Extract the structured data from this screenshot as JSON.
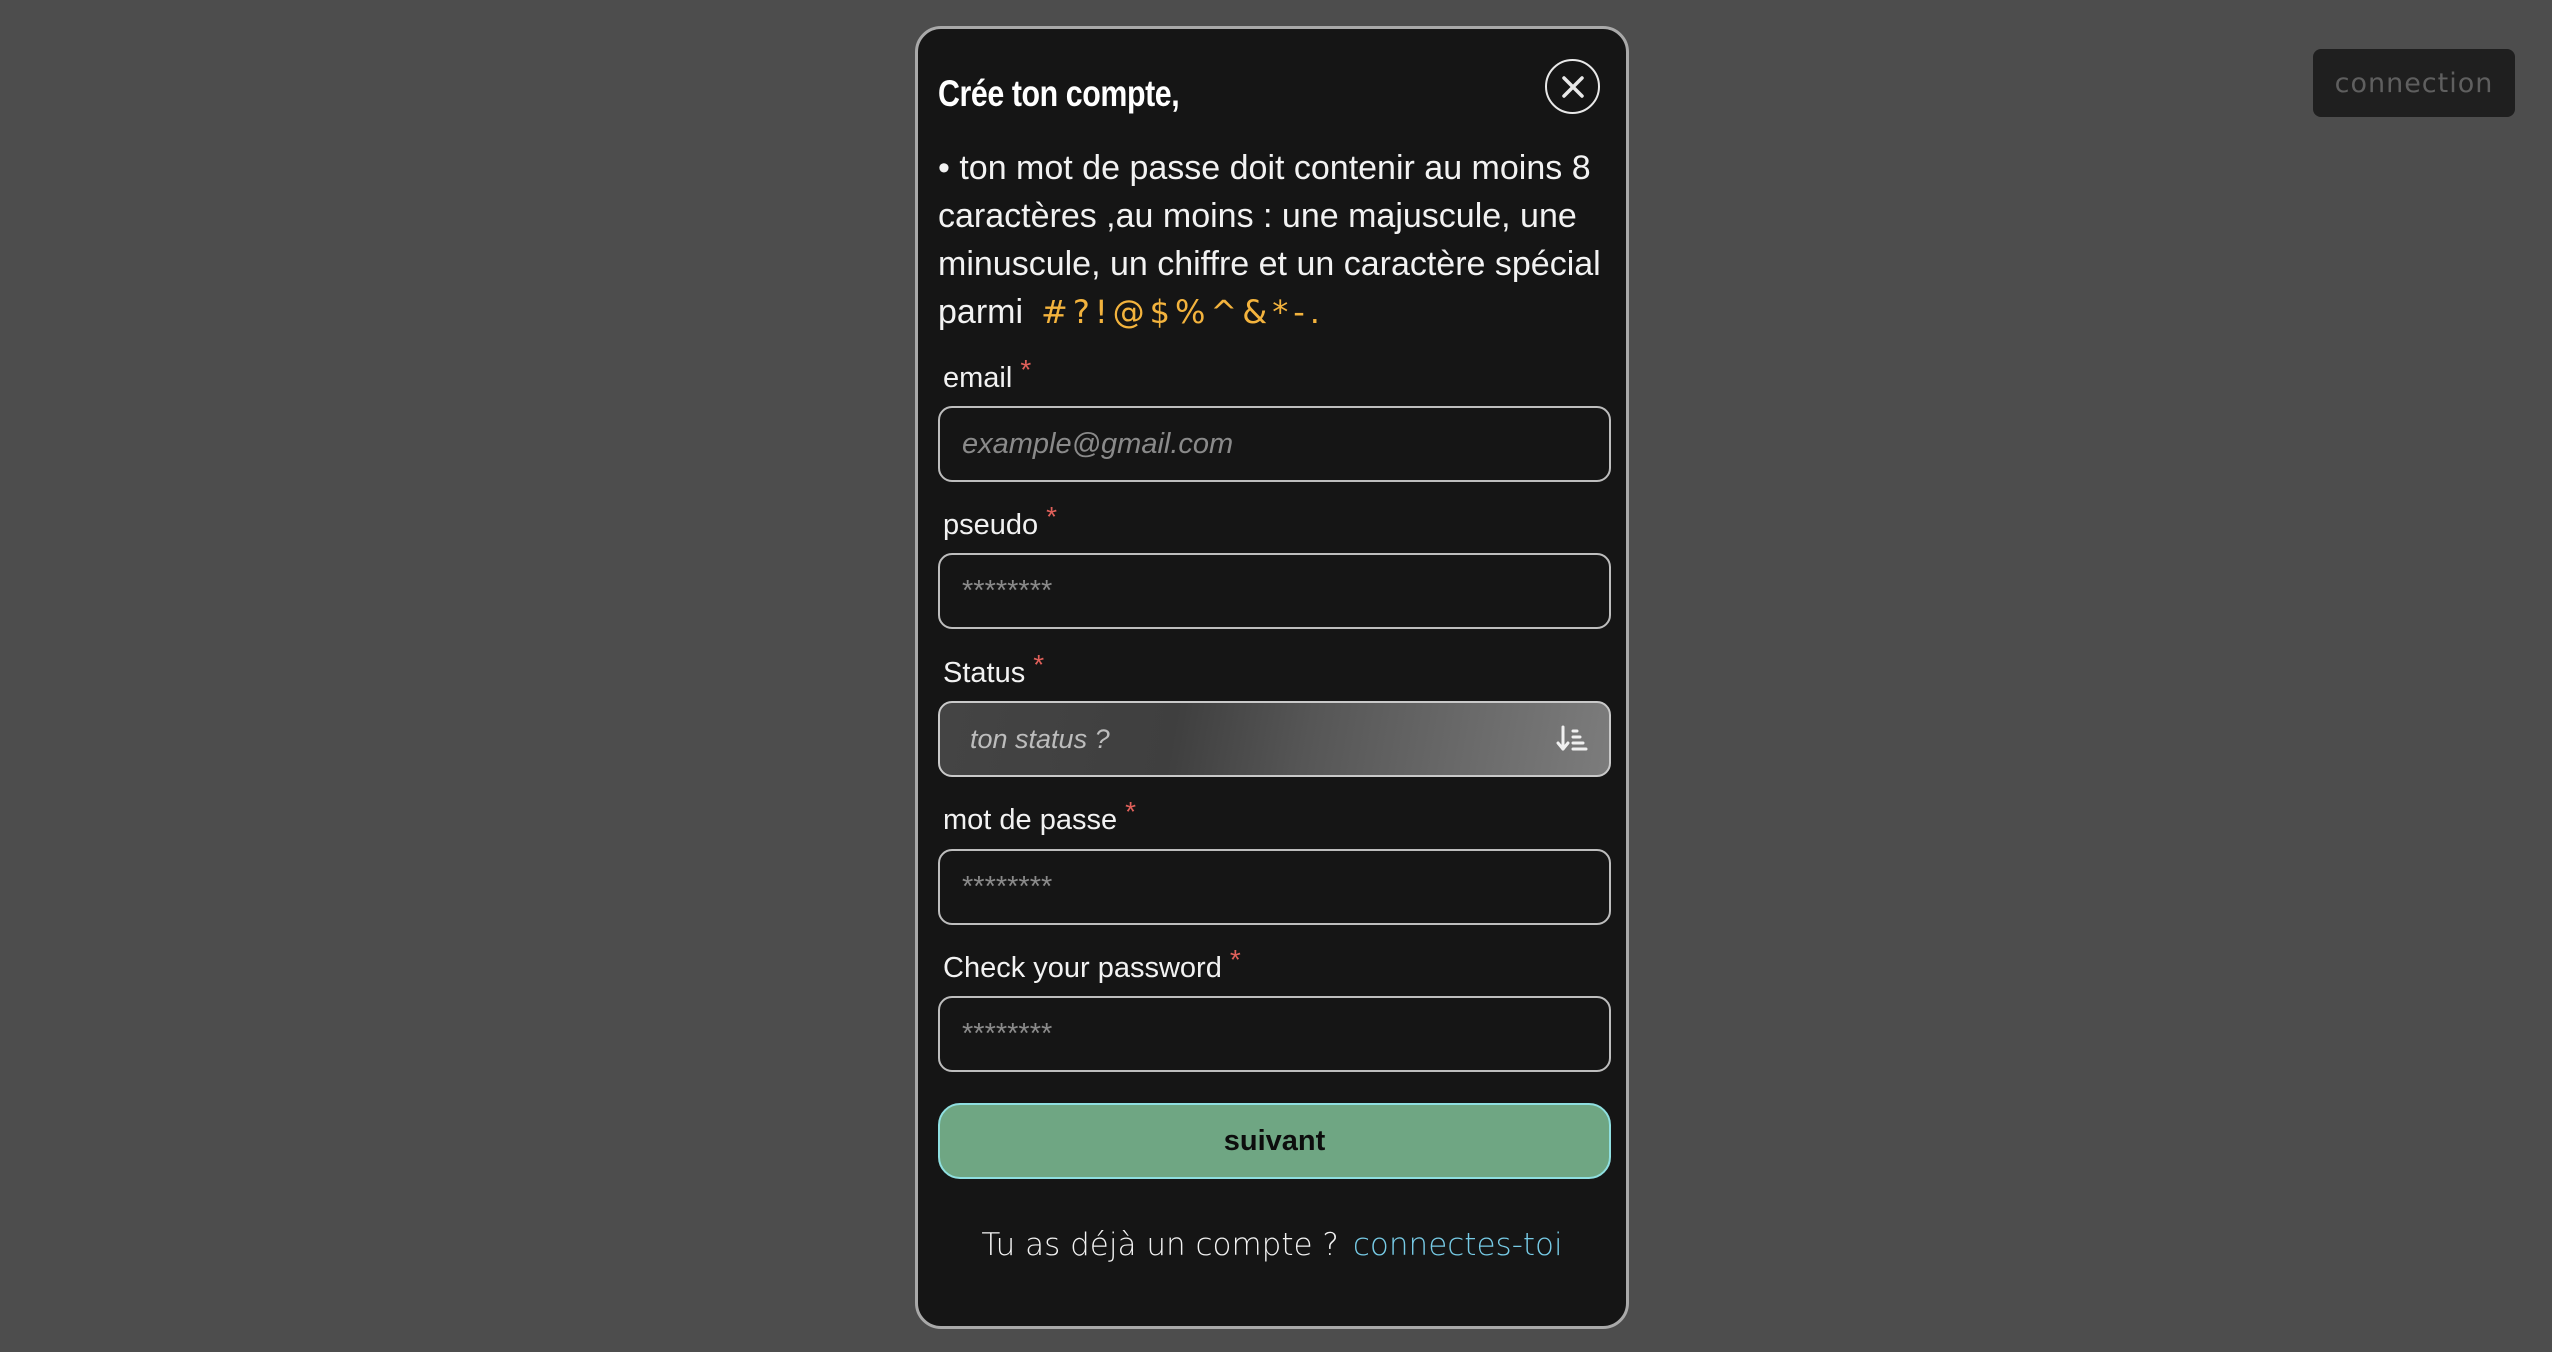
{
  "header": {
    "connection_button": "connection"
  },
  "modal": {
    "title": "Crée ton compte,",
    "info_text": "• ton mot de passe doit contenir au moins 8 caractères ,au moins : une majuscule, une minuscule, un chiffre et un caractère spécial parmi",
    "special_chars": "#?!@$%^&*-.",
    "required_marker": "*",
    "fields": {
      "email": {
        "label": "email",
        "placeholder": "example@gmail.com",
        "value": ""
      },
      "pseudo": {
        "label": "pseudo",
        "placeholder": "********",
        "value": ""
      },
      "status": {
        "label": "Status",
        "selected": "ton status ?"
      },
      "password": {
        "label": "mot de passe",
        "placeholder": "********",
        "value": ""
      },
      "check_password": {
        "label": "Check your password",
        "placeholder": "********",
        "value": ""
      }
    },
    "submit_label": "suivant",
    "footer_text": "Tu as déjà un compte ?",
    "footer_link": "connectes-toi"
  },
  "colors": {
    "background": "#4d4d4d",
    "modal_bg": "#151515",
    "accent_green": "#6fa683",
    "special_chars": "#f3b33d",
    "link": "#77cbe6",
    "required": "#e0605a"
  },
  "icons": {
    "close": "close-icon",
    "status_sort": "sort-descending-icon"
  }
}
